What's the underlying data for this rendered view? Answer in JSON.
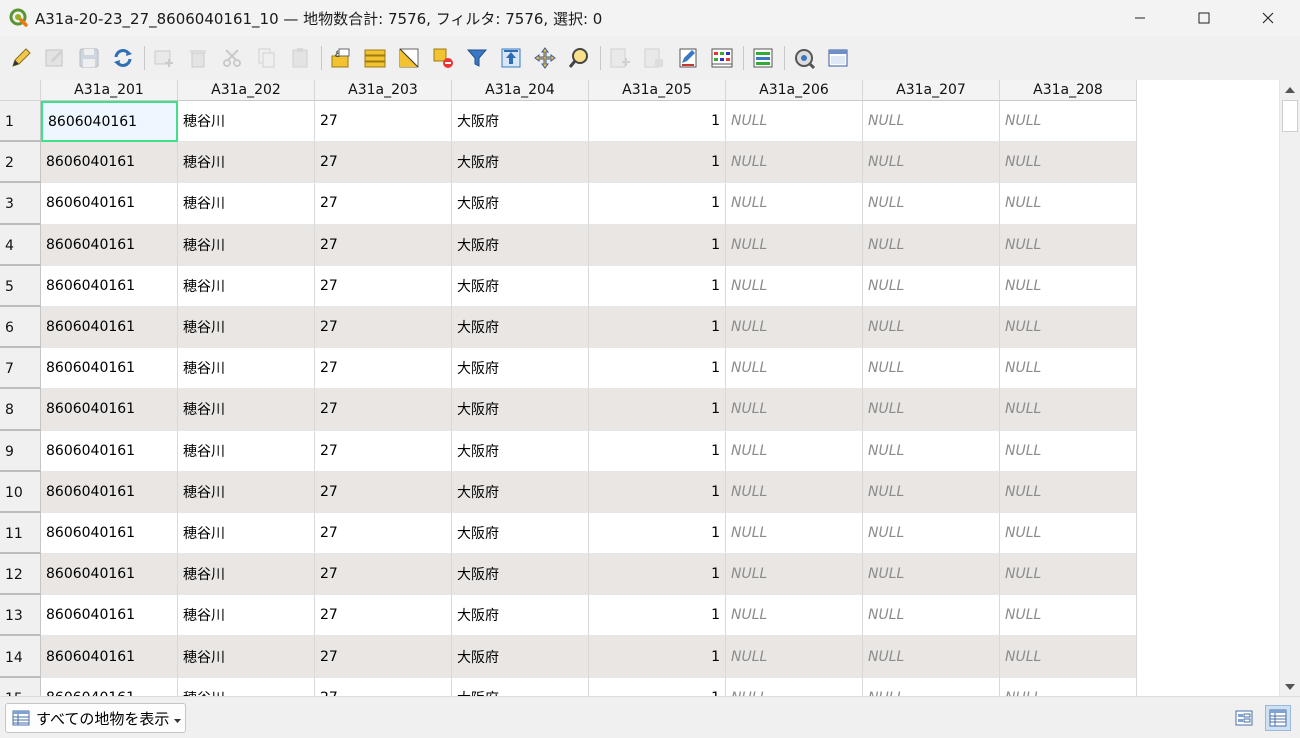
{
  "window": {
    "title": "A31a-20-23_27_8606040161_10 — 地物数合計: 7576, フィルタ: 7576, 選択: 0"
  },
  "columns": [
    "A31a_201",
    "A31a_202",
    "A31a_203",
    "A31a_204",
    "A31a_205",
    "A31a_206",
    "A31a_207",
    "A31a_208"
  ],
  "rows": [
    {
      "num": "1",
      "values": [
        "8606040161",
        "穂谷川",
        "27",
        "大阪府",
        "1",
        "NULL",
        "NULL",
        "NULL"
      ]
    },
    {
      "num": "2",
      "values": [
        "8606040161",
        "穂谷川",
        "27",
        "大阪府",
        "1",
        "NULL",
        "NULL",
        "NULL"
      ]
    },
    {
      "num": "3",
      "values": [
        "8606040161",
        "穂谷川",
        "27",
        "大阪府",
        "1",
        "NULL",
        "NULL",
        "NULL"
      ]
    },
    {
      "num": "4",
      "values": [
        "8606040161",
        "穂谷川",
        "27",
        "大阪府",
        "1",
        "NULL",
        "NULL",
        "NULL"
      ]
    },
    {
      "num": "5",
      "values": [
        "8606040161",
        "穂谷川",
        "27",
        "大阪府",
        "1",
        "NULL",
        "NULL",
        "NULL"
      ]
    },
    {
      "num": "6",
      "values": [
        "8606040161",
        "穂谷川",
        "27",
        "大阪府",
        "1",
        "NULL",
        "NULL",
        "NULL"
      ]
    },
    {
      "num": "7",
      "values": [
        "8606040161",
        "穂谷川",
        "27",
        "大阪府",
        "1",
        "NULL",
        "NULL",
        "NULL"
      ]
    },
    {
      "num": "8",
      "values": [
        "8606040161",
        "穂谷川",
        "27",
        "大阪府",
        "1",
        "NULL",
        "NULL",
        "NULL"
      ]
    },
    {
      "num": "9",
      "values": [
        "8606040161",
        "穂谷川",
        "27",
        "大阪府",
        "1",
        "NULL",
        "NULL",
        "NULL"
      ]
    },
    {
      "num": "10",
      "values": [
        "8606040161",
        "穂谷川",
        "27",
        "大阪府",
        "1",
        "NULL",
        "NULL",
        "NULL"
      ]
    },
    {
      "num": "11",
      "values": [
        "8606040161",
        "穂谷川",
        "27",
        "大阪府",
        "1",
        "NULL",
        "NULL",
        "NULL"
      ]
    },
    {
      "num": "12",
      "values": [
        "8606040161",
        "穂谷川",
        "27",
        "大阪府",
        "1",
        "NULL",
        "NULL",
        "NULL"
      ]
    },
    {
      "num": "13",
      "values": [
        "8606040161",
        "穂谷川",
        "27",
        "大阪府",
        "1",
        "NULL",
        "NULL",
        "NULL"
      ]
    },
    {
      "num": "14",
      "values": [
        "8606040161",
        "穂谷川",
        "27",
        "大阪府",
        "1",
        "NULL",
        "NULL",
        "NULL"
      ]
    },
    {
      "num": "15",
      "values": [
        "8606040161",
        "穂谷川",
        "27",
        "大阪府",
        "1",
        "NULL",
        "NULL",
        "NULL"
      ]
    }
  ],
  "numeric_columns": [
    4
  ],
  "selected_cell": {
    "row": 0,
    "col": 0
  },
  "bottom": {
    "filter_label": "すべての地物を表示"
  },
  "toolbar": {
    "items": [
      {
        "icon": "pencil-icon",
        "enabled": true
      },
      {
        "icon": "multi-edit-icon",
        "enabled": false
      },
      {
        "icon": "save-icon",
        "enabled": false
      },
      {
        "icon": "reload-icon",
        "enabled": true
      },
      {
        "sep": true
      },
      {
        "icon": "add-feature-icon",
        "enabled": false
      },
      {
        "icon": "delete-icon",
        "enabled": false
      },
      {
        "icon": "cut-icon",
        "enabled": false
      },
      {
        "icon": "copy-icon",
        "enabled": false
      },
      {
        "icon": "paste-icon",
        "enabled": false
      },
      {
        "sep": true
      },
      {
        "icon": "select-expression-icon",
        "enabled": true
      },
      {
        "icon": "select-all-icon",
        "enabled": true
      },
      {
        "icon": "invert-selection-icon",
        "enabled": true
      },
      {
        "icon": "deselect-icon",
        "enabled": true
      },
      {
        "icon": "filter-icon",
        "enabled": true
      },
      {
        "icon": "move-to-top-icon",
        "enabled": true
      },
      {
        "icon": "pan-to-icon",
        "enabled": true
      },
      {
        "icon": "zoom-to-icon",
        "enabled": true
      },
      {
        "sep": true
      },
      {
        "icon": "new-field-icon",
        "enabled": false
      },
      {
        "icon": "delete-field-icon",
        "enabled": false
      },
      {
        "icon": "field-calculator-icon",
        "enabled": true
      },
      {
        "icon": "conditional-format-icon",
        "enabled": true
      },
      {
        "sep": true
      },
      {
        "icon": "organize-columns-icon",
        "enabled": true
      },
      {
        "sep": true
      },
      {
        "icon": "actions-icon",
        "enabled": true
      },
      {
        "icon": "dock-icon",
        "enabled": true
      }
    ]
  },
  "colors": {
    "alt_row": "#e9e6e3",
    "selection_border": "#3ee08a",
    "null_text": "#8c8c8c"
  }
}
